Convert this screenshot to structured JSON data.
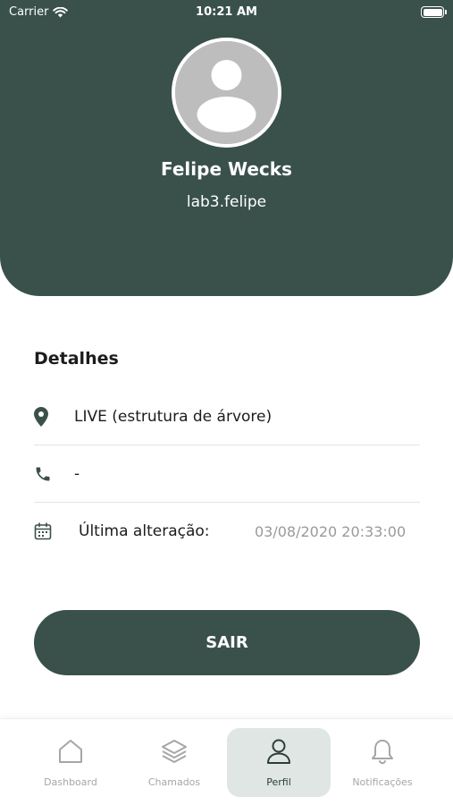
{
  "status_bar": {
    "carrier": "Carrier",
    "time": "10:21 AM",
    "battery_level": 1.0
  },
  "profile": {
    "name": "Felipe Wecks",
    "username": "lab3.felipe",
    "avatar_icon": "user-placeholder-icon"
  },
  "details": {
    "title": "Detalhes",
    "location": "LIVE (estrutura de árvore)",
    "phone": "-",
    "last_change_label": "Última alteração:",
    "last_change_value": "03/08/2020 20:33:00"
  },
  "logout": {
    "label": "SAIR"
  },
  "nav": {
    "items": [
      {
        "label": "Dashboard",
        "icon": "home-icon"
      },
      {
        "label": "Chamados",
        "icon": "layers-icon"
      },
      {
        "label": "Perfil",
        "icon": "user-icon",
        "active": true
      },
      {
        "label": "Notificações",
        "icon": "bell-icon"
      }
    ]
  },
  "colors": {
    "primary": "#3a514b",
    "nav_active_bg": "#dfe6e3",
    "muted_text": "#9a9a9a"
  }
}
